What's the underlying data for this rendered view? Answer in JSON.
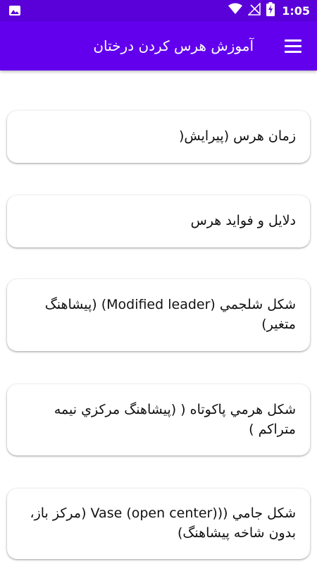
{
  "status_bar": {
    "time": "1:05",
    "icons": [
      "image-icon",
      "wifi-icon",
      "no-signal-icon",
      "battery-charging-icon"
    ]
  },
  "app_bar": {
    "title": "آموزش هرس کردن درختان",
    "menu_icon": "hamburger-menu-icon"
  },
  "colors": {
    "primary": "#6200ee",
    "primary_dark": "#5a00d8",
    "card_bg": "#ffffff",
    "text": "#111111"
  },
  "list": {
    "items": [
      {
        "label": "زمان هرس (پيرايش("
      },
      {
        "label": "دلايل و فوايد هرس"
      },
      {
        "label": "شكل شلجمي (Modified leader) (پيشاهنگ متغير)"
      },
      {
        "label": "شكل هرمي پاكوتاه ( (پيشاهنگ مركزي نيمه متراكم )"
      },
      {
        "label": "شكل جامي ((Vase (open center) (مركز باز، بدون شاخه پيشاهنگ)"
      }
    ]
  }
}
